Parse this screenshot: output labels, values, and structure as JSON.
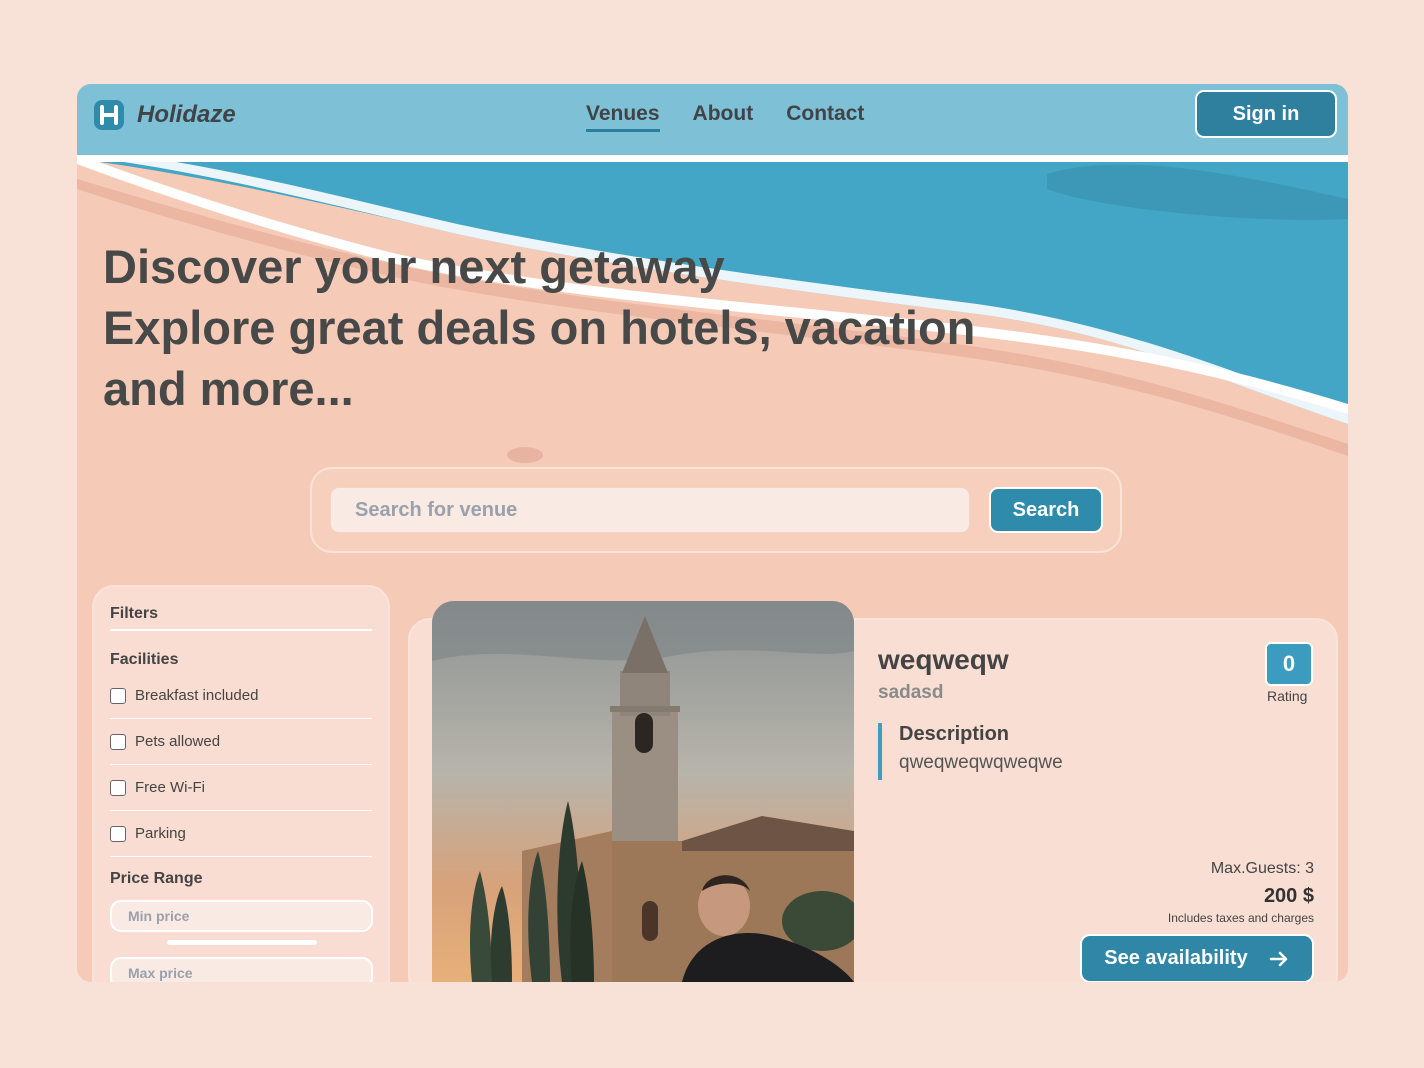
{
  "brand": {
    "name": "Holidaze",
    "logo_icon": "h-logo-icon"
  },
  "nav": {
    "links": [
      {
        "label": "Venues",
        "active": true
      },
      {
        "label": "About",
        "active": false
      },
      {
        "label": "Contact",
        "active": false
      }
    ],
    "signin_label": "Sign in"
  },
  "hero": {
    "line1": "Discover your next getaway",
    "line2": "Explore great deals on hotels, vacation",
    "line3": "and more..."
  },
  "search": {
    "placeholder": "Search for venue",
    "button_label": "Search"
  },
  "filters": {
    "title": "Filters",
    "facilities_title": "Facilities",
    "facilities": [
      {
        "label": "Breakfast included",
        "checked": false
      },
      {
        "label": "Pets allowed",
        "checked": false
      },
      {
        "label": "Free Wi-Fi",
        "checked": false
      },
      {
        "label": "Parking",
        "checked": false
      }
    ],
    "price_title": "Price Range",
    "min_placeholder": "Min price",
    "max_placeholder": "Max price"
  },
  "venue": {
    "name": "weqweqw",
    "subtitle": "sadasd",
    "description_title": "Description",
    "description": "qweqweqwqweqwe",
    "rating": "0",
    "rating_label": "Rating",
    "max_guests": "Max.Guests: 3",
    "price": "200 $",
    "price_note": "Includes taxes and charges",
    "cta_label": "See availability",
    "cta_icon": "arrow-right-icon"
  },
  "colors": {
    "page_bg": "#f8e1d7",
    "nav_bg": "#7ec1d6",
    "accent": "#2f86a6",
    "sand": "#f5cbb8",
    "water": "#43a6c6"
  }
}
